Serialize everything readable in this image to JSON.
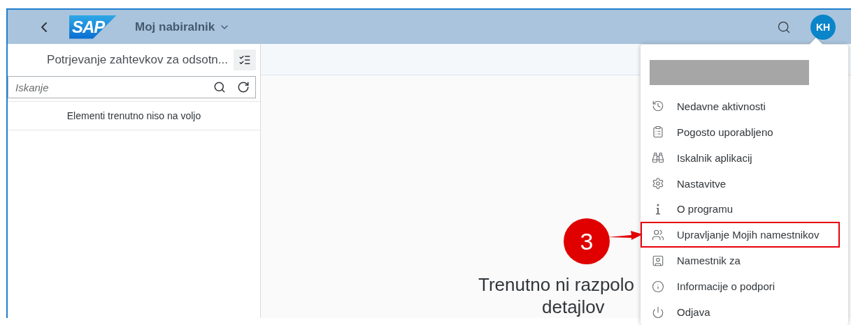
{
  "header": {
    "logo": "SAP",
    "title": "Moj nabiralnik",
    "avatar": "KH"
  },
  "master": {
    "title": "Potrjevanje zahtevkov za odsotn...",
    "search": {
      "placeholder": "Iskanje"
    },
    "empty_text": "Elementi trenutno niso na voljo"
  },
  "detail": {
    "message_lines": [
      "Trenutno ni razpolo",
      "detajlov"
    ]
  },
  "user_menu": {
    "items": [
      {
        "label": "Nedavne aktivnosti",
        "highlighted": false
      },
      {
        "label": "Pogosto uporabljeno",
        "highlighted": false
      },
      {
        "label": "Iskalnik aplikacij",
        "highlighted": false
      },
      {
        "label": "Nastavitve",
        "highlighted": false
      },
      {
        "label": "O programu",
        "highlighted": false
      },
      {
        "label": "Upravljanje Mojih namestnikov",
        "highlighted": true
      },
      {
        "label": "Namestnik za",
        "highlighted": false
      },
      {
        "label": "Informacije o podpori",
        "highlighted": false
      },
      {
        "label": "Odjava",
        "highlighted": false
      }
    ]
  },
  "annotation": {
    "label": "3"
  }
}
